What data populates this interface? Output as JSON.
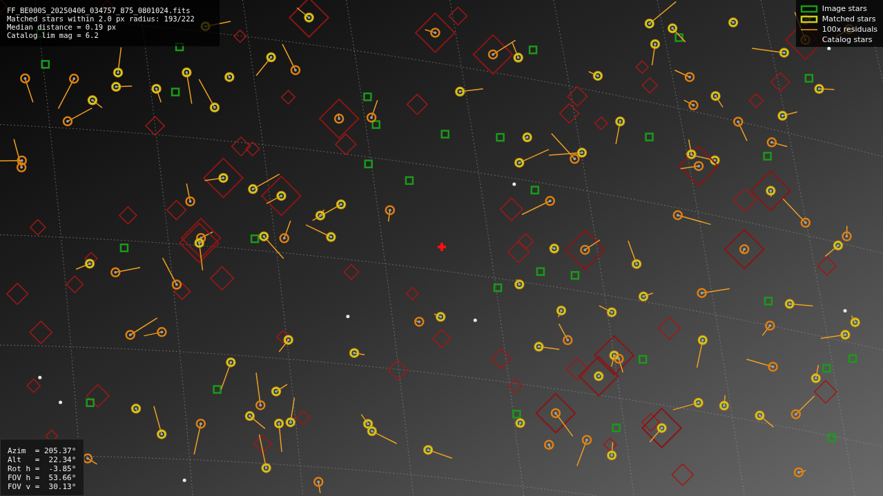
{
  "info_box": {
    "lines": [
      "FF_BE000S_20250406_034757_875_0801024.fits",
      "Matched stars within 2.0 px radius: 193/222",
      "Median distance = 0.19 px",
      "Catalog lim mag = 6.2"
    ]
  },
  "legend": {
    "items": [
      {
        "label": "Image stars"
      },
      {
        "kind": "matched",
        "label": "Matched stars"
      },
      {
        "kind": "residual",
        "label": "100x residuals"
      },
      {
        "kind": "catalog",
        "label": "Catalog stars"
      }
    ]
  },
  "pointing_box": {
    "lines": [
      "Azim  = 205.37°",
      "Alt   =  22.34°",
      "Rot h =  -3.85°",
      "FOV h =  53.66°",
      "FOV v =  30.13°"
    ]
  }
}
